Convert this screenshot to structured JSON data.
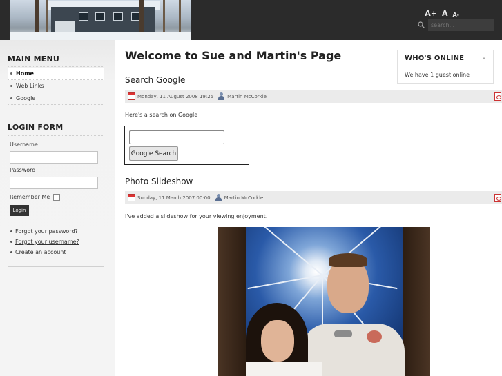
{
  "header": {
    "font_controls": {
      "larger": "A+",
      "reset": "A",
      "smaller": "A-"
    },
    "search": {
      "placeholder": "search..."
    },
    "icons": {
      "search": "search-icon"
    }
  },
  "sidebar": {
    "main_menu": {
      "title": "MAIN MENU",
      "items": [
        {
          "label": "Home",
          "active": true
        },
        {
          "label": "Web Links",
          "active": false
        },
        {
          "label": "Google",
          "active": false
        }
      ]
    },
    "login_form": {
      "title": "LOGIN FORM",
      "username_label": "Username",
      "password_label": "Password",
      "remember_label": "Remember Me",
      "login_button": "Login",
      "links": [
        "Forgot your password?",
        "Forgot your username?",
        "Create an account"
      ]
    }
  },
  "main": {
    "page_title": "Welcome to Sue and Martin's Page",
    "articles": [
      {
        "title": "Search Google",
        "date": "Monday, 11 August 2008 19:25",
        "author": "Martin McCorkle",
        "intro": "Here's a search on Google",
        "google_button": "Google Search"
      },
      {
        "title": "Photo Slideshow",
        "date": "Sunday, 11 March 2007 00:00",
        "author": "Martin McCorkle",
        "intro": "I've added a slideshow for your viewing enjoyment."
      }
    ]
  },
  "right": {
    "whos_online": {
      "title": "WHO'S ONLINE",
      "text": "We have 1 guest online"
    }
  },
  "colors": {
    "header_bg": "#2b2b2b",
    "sidebar_bg": "#f4f4f4",
    "meta_bar_bg": "#ebebeb",
    "login_button_bg": "#333333"
  }
}
